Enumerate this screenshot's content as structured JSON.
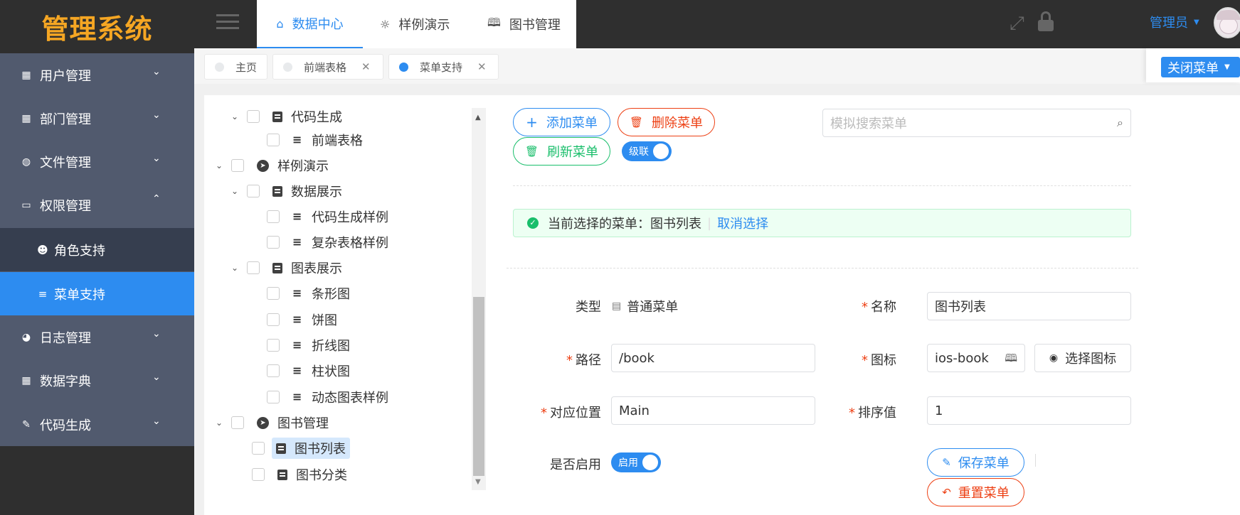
{
  "app": {
    "logo": "管理系统"
  },
  "colors": {
    "primary": "#2d8cf0",
    "danger": "#ed4014",
    "success": "#19be6b",
    "sidebar": "#515a6e"
  },
  "sidebar": {
    "items": [
      {
        "label": "用户管理",
        "icon": "chart-icon"
      },
      {
        "label": "部门管理",
        "icon": "grid-icon"
      },
      {
        "label": "文件管理",
        "icon": "globe-icon"
      },
      {
        "label": "权限管理",
        "icon": "monitor-icon"
      },
      {
        "label": "日志管理",
        "icon": "pie-icon"
      },
      {
        "label": "数据字典",
        "icon": "grid-icon"
      },
      {
        "label": "代码生成",
        "icon": "brush-icon"
      }
    ],
    "subitems": [
      {
        "label": "角色支持",
        "icon": "people-icon"
      },
      {
        "label": "菜单支持",
        "icon": "menu-lines-icon"
      }
    ]
  },
  "header": {
    "tabs": [
      {
        "label": "数据中心",
        "icon": "home-icon"
      },
      {
        "label": "样例演示",
        "icon": "bulb-icon"
      },
      {
        "label": "图书管理",
        "icon": "book-icon"
      }
    ],
    "user": "管理员"
  },
  "tags": [
    {
      "label": "主页"
    },
    {
      "label": "前端表格"
    },
    {
      "label": "菜单支持"
    }
  ],
  "close_menu": "关闭菜单",
  "tree": [
    {
      "label": "代码生成",
      "level": 1
    },
    {
      "label": "前端表格",
      "level": 2
    },
    {
      "label": "样例演示",
      "level": 0
    },
    {
      "label": "数据展示",
      "level": 1
    },
    {
      "label": "代码生成样例",
      "level": 2
    },
    {
      "label": "复杂表格样例",
      "level": 2
    },
    {
      "label": "图表展示",
      "level": 1
    },
    {
      "label": "条形图",
      "level": 2
    },
    {
      "label": "饼图",
      "level": 2
    },
    {
      "label": "折线图",
      "level": 2
    },
    {
      "label": "柱状图",
      "level": 2
    },
    {
      "label": "动态图表样例",
      "level": 2
    },
    {
      "label": "图书管理",
      "level": 0
    },
    {
      "label": "图书列表",
      "level": 1
    },
    {
      "label": "图书分类",
      "level": 1
    }
  ],
  "toolbar": {
    "add": "添加菜单",
    "delete": "删除菜单",
    "refresh": "刷新菜单",
    "cascade": "级联",
    "search_placeholder": "模拟搜索菜单"
  },
  "alert": {
    "prefix": "当前选择的菜单：",
    "value": "图书列表",
    "cancel": "取消选择"
  },
  "form": {
    "type_label": "类型",
    "type_value": "普通菜单",
    "name_label": "名称",
    "name_value": "图书列表",
    "path_label": "路径",
    "path_value": "/book",
    "icon_label": "图标",
    "icon_value": "ios-book",
    "select_icon": "选择图标",
    "component_label": "对应位置",
    "component_value": "Main",
    "sort_label": "排序值",
    "sort_value": "1",
    "enable_label": "是否启用",
    "enable_value": "启用",
    "save": "保存菜单",
    "reset": "重置菜单"
  }
}
